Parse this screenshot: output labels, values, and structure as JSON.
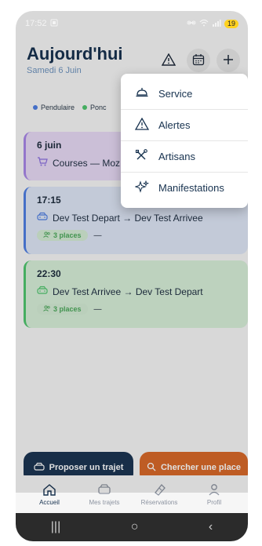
{
  "status_bar": {
    "time": "17:52",
    "battery": "19"
  },
  "header": {
    "title": "Aujourd'hui",
    "subtitle": "Samedi 6 Juin"
  },
  "header_actions": {
    "alert_icon": "warning-icon",
    "calendar_icon": "calendar-icon",
    "add_icon": "plus-icon"
  },
  "legend": [
    {
      "label": "Pendulaire",
      "color": "#4f7fe3"
    },
    {
      "label": "Ponc",
      "color": "#4fc56e"
    }
  ],
  "cards": [
    {
      "time": "6 juin",
      "route": "Courses — Moz",
      "type": "shopping"
    },
    {
      "time": "17:15",
      "route": "Dev Test Depart → Dev Test Arrivee",
      "places": "3 places",
      "dash": "—"
    },
    {
      "time": "22:30",
      "route": "Dev Test Arrivee → Dev Test Depart",
      "places": "3 places",
      "dash": "—"
    }
  ],
  "menu": [
    {
      "label": "Service",
      "icon": "service-bell-icon"
    },
    {
      "label": "Alertes",
      "icon": "warning-icon"
    },
    {
      "label": "Artisans",
      "icon": "tools-icon"
    },
    {
      "label": "Manifestations",
      "icon": "sparkle-icon"
    }
  ],
  "actions": {
    "propose": "Proposer un trajet",
    "search": "Chercher une place"
  },
  "tabs": [
    {
      "label": "Accueil"
    },
    {
      "label": "Mes trajets"
    },
    {
      "label": "Réservations"
    },
    {
      "label": "Profil"
    }
  ],
  "nav": {
    "recent": "|||",
    "home": "○",
    "back": "‹"
  }
}
